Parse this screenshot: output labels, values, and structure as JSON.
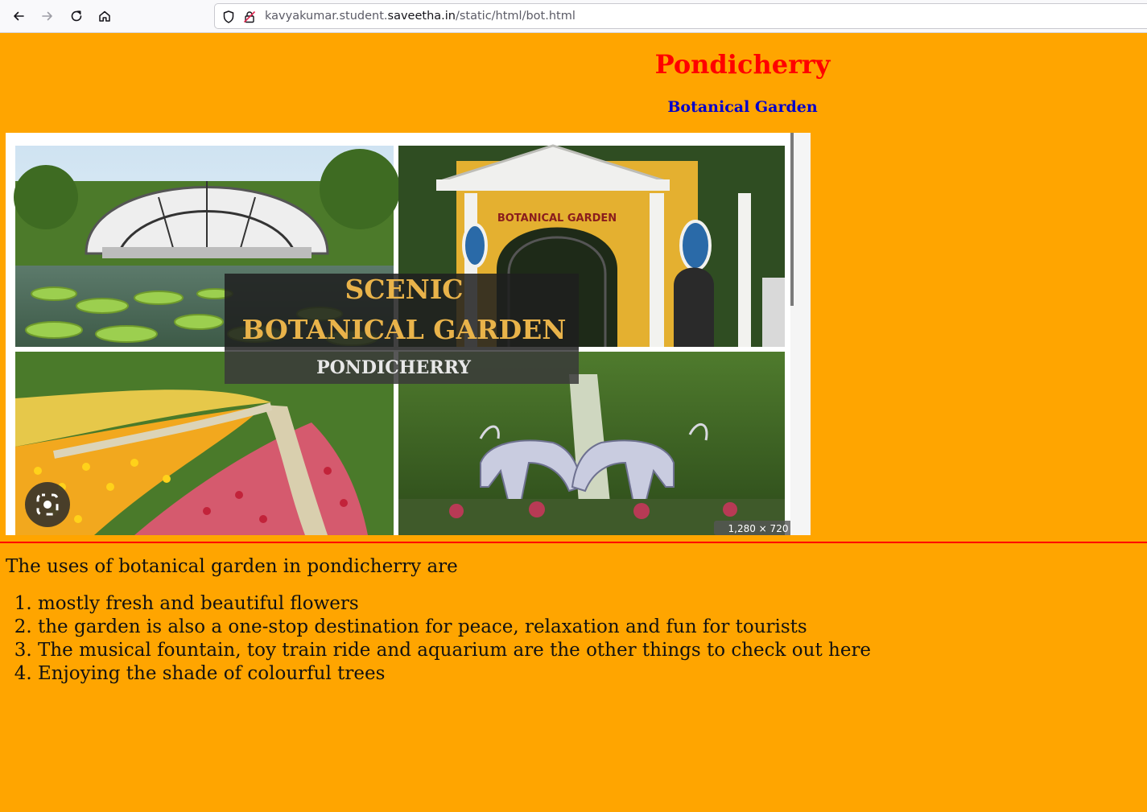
{
  "browser": {
    "url_prefix": "kavyakumar.student.",
    "url_domain": "saveetha.in",
    "url_path": "/static/html/bot.html"
  },
  "page": {
    "title": "Pondicherry",
    "subtitle": "Botanical Garden",
    "background": "#ffa500",
    "image": {
      "headline_1": "SCENIC",
      "headline_2": "BOTANICAL GARDEN",
      "headline_3": "PONDICHERRY",
      "arch_text": "BOTANICAL GARDEN",
      "size_label": "1,280 × 720"
    },
    "intro": "The uses of botanical garden in pondicherry are",
    "uses": [
      "mostly fresh and beautiful flowers",
      "the garden is also a one-stop destination for peace, relaxation and fun for tourists",
      "The musical fountain, toy train ride and aquarium are the other things to check out here",
      "Enjoying the shade of colourful trees"
    ]
  }
}
